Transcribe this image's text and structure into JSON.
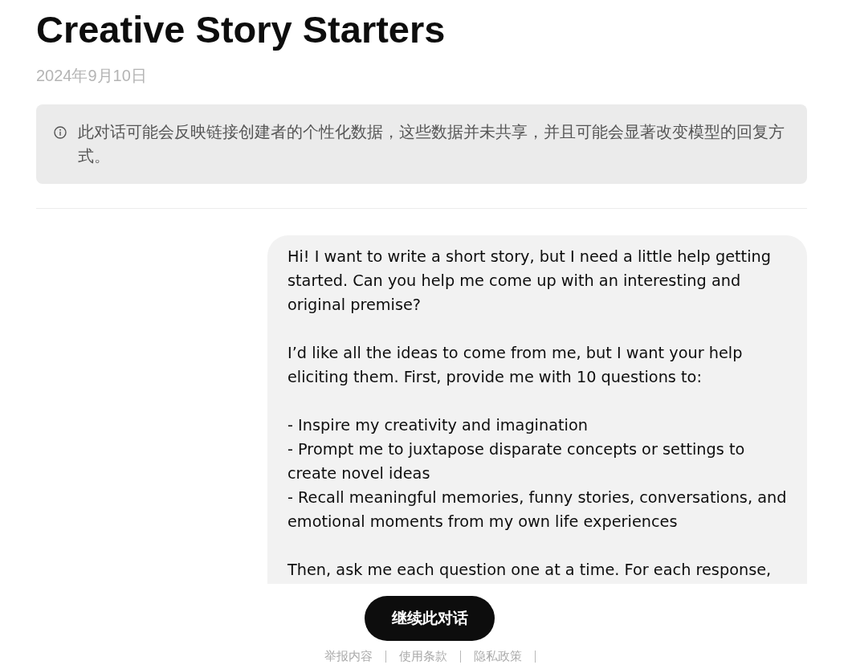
{
  "page": {
    "title": "Creative Story Starters",
    "date": "2024年9月10日"
  },
  "notice": {
    "text": "此对话可能会反映链接创建者的个性化数据，这些数据并未共享，并且可能会显著改变模型的回复方式。"
  },
  "user_message": {
    "paragraphs": [
      [
        "Hi! I want to write a short story, but I need a little help getting started. Can you help me come up with an interesting and original premise?"
      ],
      [
        "I’d like all the ideas to come from me, but I want your help eliciting them. First, provide me with 10 questions to:"
      ],
      [
        "- Inspire my creativity and imagination",
        "- Prompt me to juxtapose disparate concepts or settings to create novel ideas",
        "- Recall meaningful memories, funny stories, conversations, and emotional moments from my own life experiences"
      ],
      [
        "Then, ask me each question one at a time. For each response,"
      ]
    ]
  },
  "continue_button": {
    "label": "继续此对话"
  },
  "footer": {
    "links": [
      "举报内容",
      "使用条款",
      "隐私政策"
    ]
  }
}
